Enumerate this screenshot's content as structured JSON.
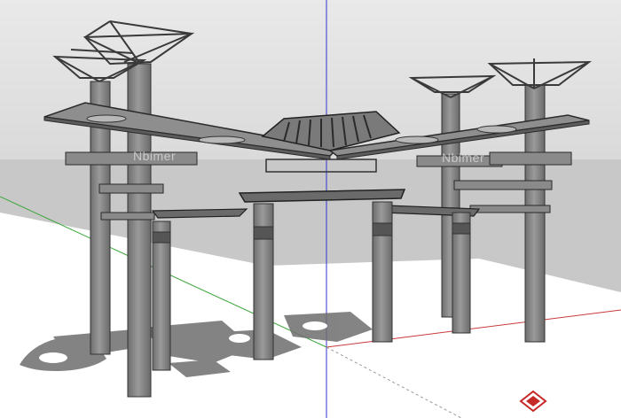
{
  "scene": {
    "type": "3d-model-viewport",
    "subject": "pergola-structure",
    "colors": {
      "sky_top": "#e6e6e6",
      "sky_bottom": "#d8d8d8",
      "ground_far": "#c8c8c8",
      "ground_plane": "#ffffff",
      "structure": "#8c8c8c",
      "structure_dark": "#5a5a5a",
      "outline": "#2a2a2a",
      "shadow": "#7a7a7a",
      "axis_blue": "#3333cc",
      "axis_green": "#33aa33",
      "axis_red": "#cc3333"
    }
  },
  "watermarks": {
    "left": "Nbimer",
    "right": "Nbimer"
  },
  "logo": {
    "icon": "red-diamond-logo-icon"
  }
}
